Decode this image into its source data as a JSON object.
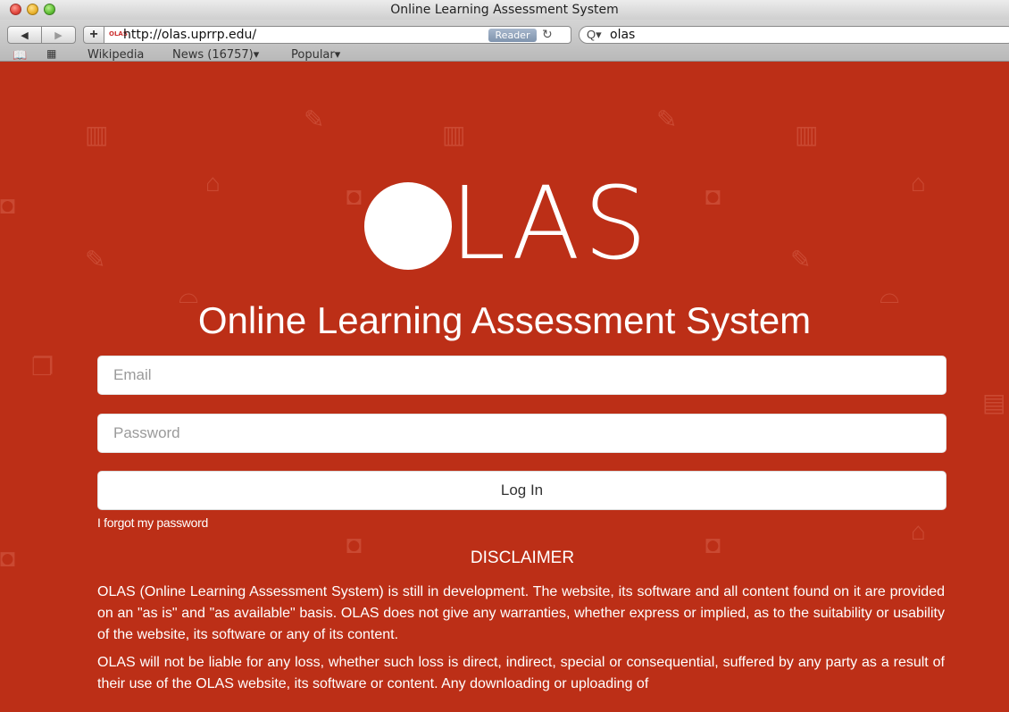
{
  "window": {
    "title": "Online Learning Assessment System"
  },
  "toolbar": {
    "back_icon": "◀",
    "forward_icon": "▶",
    "add_label": "+",
    "favicon_text": "OLAS",
    "url": "http://olas.uprrp.edu/",
    "reader_label": "Reader",
    "reload_icon": "↻",
    "search_icon": "Q▾",
    "search_value": "olas"
  },
  "bookmarks": {
    "items": [
      "Wikipedia",
      "News (16757)▾",
      "Popular▾"
    ]
  },
  "page": {
    "logo_text": "LAS",
    "system_title": "Online Learning Assessment System",
    "email_placeholder": "Email",
    "password_placeholder": "Password",
    "login_label": "Log In",
    "forgot_label": "I forgot my password",
    "disclaimer_title": "DISCLAIMER",
    "disclaimer_1": "OLAS (Online Learning Assessment System) is still in development. The website, its software and all content found on it are provided on an \"as is\" and \"as available\" basis. OLAS does not give any warranties, whether express or implied, as to the suitability or usability of the website, its software or any of its content.",
    "disclaimer_2": "OLAS will not be liable for any loss, whether such loss is direct, indirect, special or consequential, suffered by any party as a result of their use of the OLAS website, its software or content. Any downloading or uploading of"
  },
  "colors": {
    "page_background": "#bc2f17",
    "input_background": "#ffffff"
  }
}
